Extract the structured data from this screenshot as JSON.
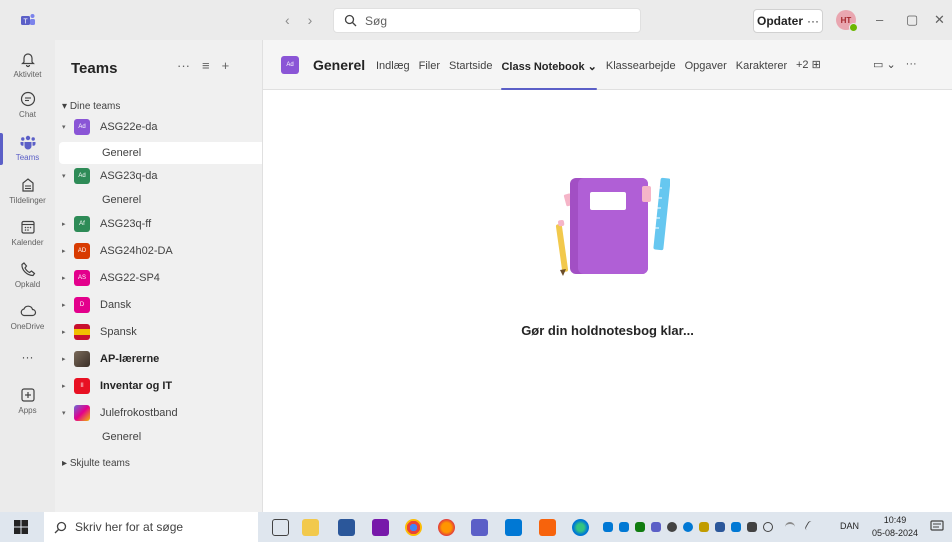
{
  "titlebar": {
    "search_placeholder": "Søg",
    "update_label": "Opdater",
    "update_more": "···",
    "avatar_initials": "HT",
    "min": "–",
    "max": "▢",
    "close": "✕",
    "back": "‹",
    "forward": "›"
  },
  "rail": {
    "items": [
      {
        "label": "Aktivitet",
        "icon": "bell-icon"
      },
      {
        "label": "Chat",
        "icon": "chat-icon"
      },
      {
        "label": "Teams",
        "icon": "teams-icon"
      },
      {
        "label": "Tildelinger",
        "icon": "assignments-icon"
      },
      {
        "label": "Kalender",
        "icon": "calendar-icon"
      },
      {
        "label": "Opkald",
        "icon": "phone-icon"
      },
      {
        "label": "OneDrive",
        "icon": "cloud-icon"
      },
      {
        "label": "···",
        "icon": "more-icon"
      },
      {
        "label": "Apps",
        "icon": "apps-icon"
      }
    ]
  },
  "panel": {
    "title": "Teams",
    "section_my_teams": "Dine teams",
    "section_hidden": "Skjulte teams",
    "teams": [
      {
        "name": "ASG22e-da",
        "abbr": "Ad",
        "color": "#8a55d6",
        "expanded": true
      },
      {
        "name": "ASG23q-da",
        "abbr": "Ad",
        "color": "#2e8b57",
        "expanded": true
      },
      {
        "name": "ASG23q-ff",
        "abbr": "Af",
        "color": "#2e8b57"
      },
      {
        "name": "ASG24h02-DA",
        "abbr": "AD",
        "color": "#d83b01"
      },
      {
        "name": "ASG22-SP4",
        "abbr": "AS",
        "color": "#e3008c"
      },
      {
        "name": "Dansk",
        "abbr": "D",
        "color": "#e3008c"
      },
      {
        "name": "Spansk",
        "abbr": "",
        "color": "#c8102e"
      },
      {
        "name": "AP-lærerne",
        "abbr": "",
        "color": "#5a4a3a",
        "bold": true
      },
      {
        "name": "Inventar og IT",
        "abbr": "II",
        "color": "#e81123",
        "bold": true
      },
      {
        "name": "Julefrokostband",
        "abbr": "",
        "color": "#6b69d6",
        "expanded": true
      }
    ],
    "channel_general": "Generel"
  },
  "main": {
    "channel_avatar": "Ad",
    "channel_name": "Generel",
    "tabs": [
      "Indlæg",
      "Filer",
      "Startside",
      "Class Notebook ⌄",
      "Klassearbejde",
      "Opgaver",
      "Karakterer"
    ],
    "tabs_more": "+2 ⊞",
    "video_icon": "▭ ⌄",
    "more": "···",
    "empty_message": "Gør din holdnotesbog klar..."
  },
  "taskbar": {
    "search_placeholder": "Skriv her for at søge",
    "lang": "DAN",
    "time": "10:49",
    "date": "05-08-2024"
  }
}
